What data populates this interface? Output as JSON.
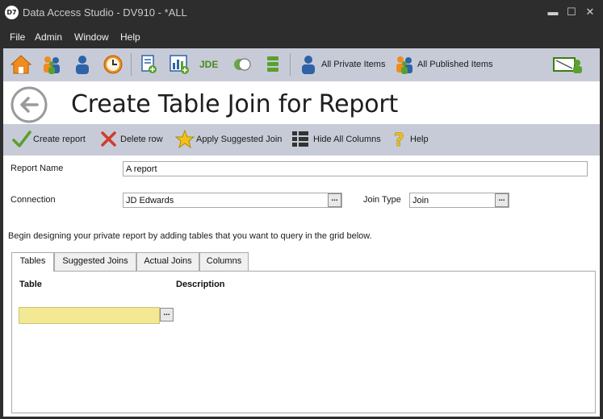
{
  "app": {
    "logo_text": "D7",
    "title": "Data Access Studio - DV910 - *ALL"
  },
  "window_controls": {
    "minimize": "▬",
    "maximize": "☐",
    "close": "✕"
  },
  "menu": [
    "File",
    "Admin",
    "Window",
    "Help"
  ],
  "toolbar": {
    "icons": [
      "home-icon",
      "users-icon",
      "user-icon",
      "clock-icon",
      "report-add-icon",
      "chart-add-icon",
      "jde-icon",
      "toggle-icon",
      "list-icon"
    ],
    "jde_text": "JDE",
    "all_private_items": "All Private Items",
    "all_published_items": "All Published Items",
    "colors": {
      "bar": "#c7cbd7",
      "orange": "#f08c1e",
      "blue": "#2e63a8",
      "green": "#5aa02c"
    }
  },
  "page": {
    "title": "Create Table Join for Report"
  },
  "actions": {
    "create_report": "Create report",
    "delete_row": "Delete row",
    "apply_suggested_join": "Apply Suggested Join",
    "hide_all_columns": "Hide All Columns",
    "help": "Help"
  },
  "form": {
    "report_name_label": "Report Name",
    "report_name_value": "A report",
    "connection_label": "Connection",
    "connection_value": "JD Edwards",
    "join_type_label": "Join Type",
    "join_type_value": "Join",
    "ellipsis": "...",
    "instructions": "Begin designing your private report by adding tables that you want to query in the grid below."
  },
  "tabs": [
    {
      "label": "Tables",
      "active": true
    },
    {
      "label": "Suggested Joins",
      "active": false
    },
    {
      "label": "Actual Joins",
      "active": false
    },
    {
      "label": "Columns",
      "active": false
    }
  ],
  "grid": {
    "columns": [
      "Table",
      "Description"
    ],
    "new_row_value": "",
    "new_row_color": "#f3e894"
  }
}
